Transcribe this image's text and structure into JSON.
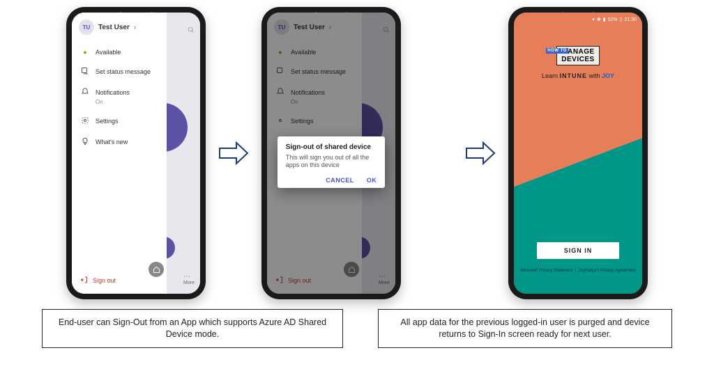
{
  "user": {
    "initials": "TU",
    "name": "Test User"
  },
  "drawer": {
    "available": "Available",
    "statusMsg": "Set status message",
    "notifications": "Notifications",
    "notificationsState": "On",
    "settings": "Settings",
    "whatsnew": "What's new",
    "signout": "Sign out",
    "more": "More"
  },
  "dialog": {
    "title": "Sign-out of shared device",
    "body": "This will sign you out of all the apps on this device",
    "cancel": "CANCEL",
    "ok": "OK"
  },
  "kiosk": {
    "logo_line1": "MANAGE",
    "logo_line2": "DEVICES",
    "howto": "HOW TO",
    "tag_learn": "Learn",
    "tag_intune": "INTUNE",
    "tag_with": "with",
    "tag_joy": "JOY",
    "signin": "SIGN IN",
    "link1": "Microsoft Privacy Statement",
    "link2": "Joymalya's Privacy Agreement",
    "battery": "52%",
    "time": "21:30"
  },
  "captions": {
    "left": "End-user can Sign-Out from an App which supports Azure AD Shared Device mode.",
    "right": "All app data for the previous logged-in user is purged and device returns to Sign-In screen ready for next user."
  }
}
